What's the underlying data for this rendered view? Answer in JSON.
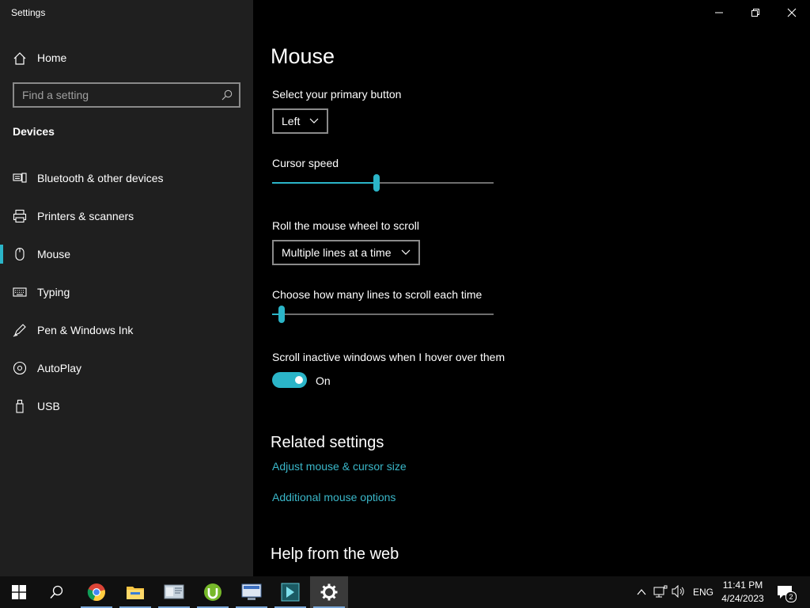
{
  "window": {
    "title": "Settings"
  },
  "sidebar": {
    "home_label": "Home",
    "search_placeholder": "Find a setting",
    "section_title": "Devices",
    "items": [
      {
        "label": "Bluetooth & other devices",
        "icon": "bluetooth-devices-icon"
      },
      {
        "label": "Printers & scanners",
        "icon": "printer-icon"
      },
      {
        "label": "Mouse",
        "icon": "mouse-icon",
        "active": true
      },
      {
        "label": "Typing",
        "icon": "keyboard-icon"
      },
      {
        "label": "Pen & Windows Ink",
        "icon": "pen-icon"
      },
      {
        "label": "AutoPlay",
        "icon": "autoplay-icon"
      },
      {
        "label": "USB",
        "icon": "usb-icon"
      }
    ]
  },
  "main": {
    "title": "Mouse",
    "primary_button": {
      "label": "Select your primary button",
      "value": "Left"
    },
    "cursor_speed": {
      "label": "Cursor speed",
      "value_fraction": 0.47
    },
    "scroll_mode": {
      "label": "Roll the mouse wheel to scroll",
      "value": "Multiple lines at a time"
    },
    "scroll_lines": {
      "label": "Choose how many lines to scroll each time",
      "value_fraction": 0.03
    },
    "inactive_scroll": {
      "label": "Scroll inactive windows when I hover over them",
      "state": "On"
    },
    "related": {
      "title": "Related settings",
      "links": [
        "Adjust mouse & cursor size",
        "Additional mouse options"
      ]
    },
    "help_title": "Help from the web"
  },
  "taskbar": {
    "apps": [
      "start-icon",
      "search-icon",
      "chrome-icon",
      "file-explorer-icon",
      "app-icon",
      "utorrent-icon",
      "app-icon",
      "media-player-icon",
      "settings-icon"
    ],
    "language": "ENG",
    "time": "11:41 PM",
    "date": "4/24/2023",
    "notification_count": "2"
  },
  "colors": {
    "accent": "#2bb5c8",
    "link": "#3ab7c9",
    "sidebar_bg": "#1f1f1f",
    "main_bg": "#000000"
  }
}
